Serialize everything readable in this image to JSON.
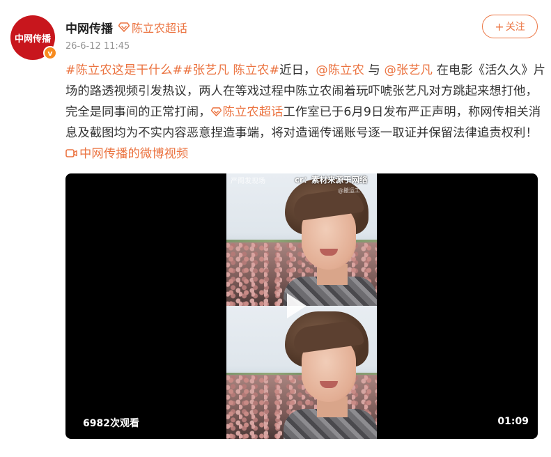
{
  "post": {
    "avatar_text": "中网传播",
    "verified_badge": "v",
    "username": "中网传播",
    "supertopic_label": "陈立农超话",
    "timestamp": "26-6-12 11:45",
    "follow_label": "关注",
    "follow_plus": "+"
  },
  "content": {
    "hashtag1": "#陈立农这是干什么#",
    "hashtag2": "#张艺凡 陈立农#",
    "text1": "近日，",
    "mention1": "@陈立农",
    "text2": " 与 ",
    "mention2": "@张艺凡",
    "text3": " 在电影《活久久》片场的路透视频引发热议，两人在等戏过程中陈立农闹着玩吓唬张艺凡对方跳起来想打他，完全是同事间的正常打闹，",
    "supertopic_link": "陈立农超话",
    "text4": "工作室已于6月9日发布严正声明，称网传相关消息及截图均为不实内容恶意捏造事端，将对造谣传谣账号逐一取证并保留法律追责权利！",
    "video_link": "中网传播的微博视频"
  },
  "video": {
    "watermark_left": "严阁发现场",
    "watermark_credit": "cr：素材来源于网络",
    "watermark_weibo": "@搬运工",
    "view_count": "6982次观看",
    "duration": "01:09"
  },
  "icons": {
    "supertopic": "diamond-icon",
    "video_link": "video-icon",
    "play": "play-icon"
  },
  "colors": {
    "accent": "#eb7340",
    "avatar_bg": "#c8161d",
    "badge": "#f78b1f",
    "text": "#333333",
    "muted": "#939393"
  }
}
